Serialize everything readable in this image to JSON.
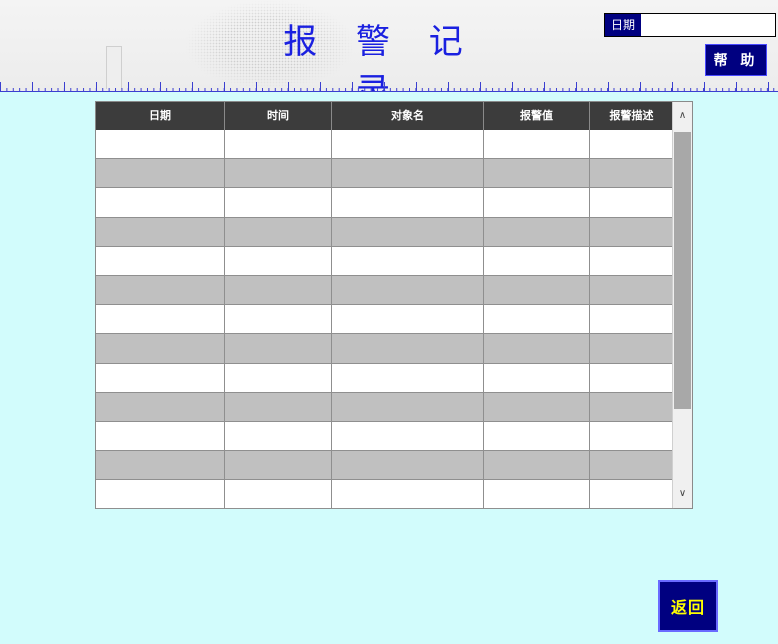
{
  "header": {
    "title": "报 警 记 录",
    "date_label": "日期",
    "date_value": "",
    "help_label": "帮 助"
  },
  "table": {
    "columns": [
      "日期",
      "时间",
      "对象名",
      "报警值",
      "报警描述"
    ],
    "rows": [
      [
        "",
        "",
        "",
        "",
        ""
      ],
      [
        "",
        "",
        "",
        "",
        ""
      ],
      [
        "",
        "",
        "",
        "",
        ""
      ],
      [
        "",
        "",
        "",
        "",
        ""
      ],
      [
        "",
        "",
        "",
        "",
        ""
      ],
      [
        "",
        "",
        "",
        "",
        ""
      ],
      [
        "",
        "",
        "",
        "",
        ""
      ],
      [
        "",
        "",
        "",
        "",
        ""
      ],
      [
        "",
        "",
        "",
        "",
        ""
      ],
      [
        "",
        "",
        "",
        "",
        ""
      ],
      [
        "",
        "",
        "",
        "",
        ""
      ],
      [
        "",
        "",
        "",
        "",
        ""
      ],
      [
        "",
        "",
        "",
        "",
        ""
      ]
    ]
  },
  "scrollbar": {
    "up_icon": "chevron-up-icon",
    "down_icon": "chevron-down-icon"
  },
  "footer": {
    "back_label": "返回"
  },
  "colors": {
    "background": "#d2fcfc",
    "title": "#1a20e0",
    "button_bg": "#000080",
    "back_text": "#ffff00",
    "header_row": "#3c3c3c",
    "alt_row": "#c0c0c0"
  }
}
